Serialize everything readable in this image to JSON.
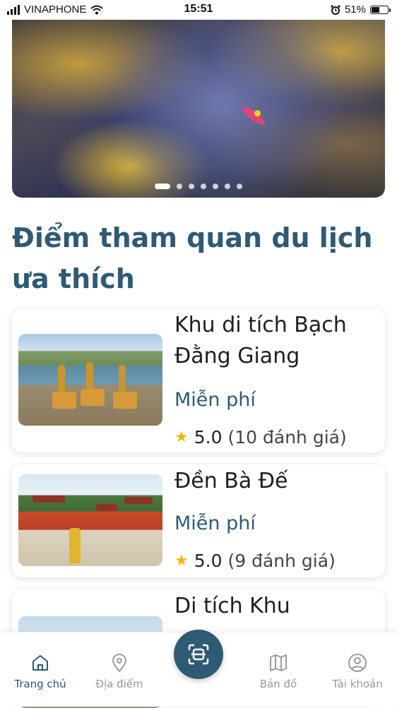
{
  "status_bar": {
    "carrier": "VINAPHONE",
    "time": "15:51",
    "battery_percent": "51%",
    "battery_level": 0.51
  },
  "banner": {
    "slide_count": 7,
    "active_slide": 0
  },
  "section": {
    "title": "Điểm tham quan du lịch ưa thích"
  },
  "places": [
    {
      "name": "Khu di tích Bạch Đằng Giang",
      "price": "Miễn phí",
      "rating": "5.0",
      "reviews": "(10 đánh giá)"
    },
    {
      "name": "Đền Bà Đế",
      "price": "Miễn phí",
      "rating": "5.0",
      "reviews": "(9 đánh giá)"
    },
    {
      "name": "Di tích Khu"
    }
  ],
  "bottom_nav": {
    "items": [
      {
        "label": "Trang chủ",
        "icon": "home-icon",
        "active": true
      },
      {
        "label": "Địa điểm",
        "icon": "location-pin-icon",
        "active": false
      },
      {
        "label": "Bản đồ",
        "icon": "map-icon",
        "active": false
      },
      {
        "label": "Tài khoản",
        "icon": "account-icon",
        "active": false
      }
    ],
    "center_button_icon": "scan-icon"
  },
  "colors": {
    "primary": "#2f5a73",
    "star": "#f2b705",
    "inactive": "#9a9a9a"
  }
}
